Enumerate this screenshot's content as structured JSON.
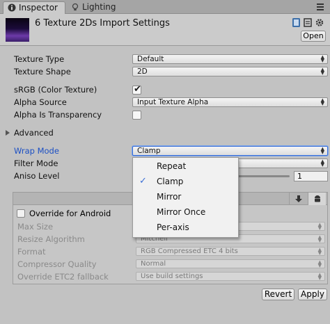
{
  "tabs": [
    {
      "label": "Inspector",
      "icon": "info-icon",
      "active": true
    },
    {
      "label": "Lighting",
      "icon": "lighting-icon",
      "active": false
    }
  ],
  "header": {
    "title": "6 Texture 2Ds Import Settings",
    "open_label": "Open"
  },
  "fields": {
    "texture_type": {
      "label": "Texture Type",
      "value": "Default"
    },
    "texture_shape": {
      "label": "Texture Shape",
      "value": "2D"
    },
    "srgb": {
      "label": "sRGB (Color Texture)",
      "checked": true
    },
    "alpha_source": {
      "label": "Alpha Source",
      "value": "Input Texture Alpha"
    },
    "alpha_transparency": {
      "label": "Alpha Is Transparency",
      "checked": false
    },
    "advanced": {
      "label": "Advanced"
    },
    "wrap_mode": {
      "label": "Wrap Mode",
      "value": "Clamp"
    },
    "filter_mode": {
      "label": "Filter Mode"
    },
    "aniso_level": {
      "label": "Aniso Level",
      "value": "1"
    }
  },
  "platform": {
    "override_label": "Override for Android",
    "max_size": {
      "label": "Max Size"
    },
    "resize_algorithm": {
      "label": "Resize Algorithm",
      "value": "Mitchell"
    },
    "format": {
      "label": "Format",
      "value": "RGB Compressed ETC 4 bits"
    },
    "compressor_quality": {
      "label": "Compressor Quality",
      "value": "Normal"
    },
    "override_etc2": {
      "label": "Override ETC2 fallback",
      "value": "Use build settings"
    }
  },
  "buttons": {
    "revert": "Revert",
    "apply": "Apply"
  },
  "wrap_menu": {
    "items": [
      {
        "label": "Repeat",
        "selected": false
      },
      {
        "label": "Clamp",
        "selected": true
      },
      {
        "label": "Mirror",
        "selected": false
      },
      {
        "label": "Mirror Once",
        "selected": false
      },
      {
        "label": "Per-axis",
        "selected": false
      }
    ],
    "check_glyph": "✓"
  },
  "colors": {
    "accent": "#3a6fd6",
    "focus_label": "#1b4fc4"
  }
}
